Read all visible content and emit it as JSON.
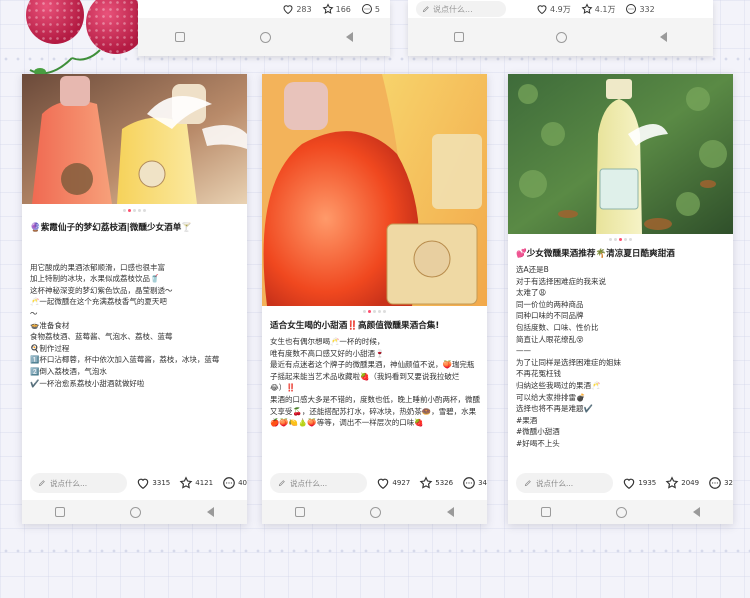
{
  "top": {
    "left": {
      "likes": "283",
      "stars": "166",
      "comments": "5"
    },
    "right": {
      "comment_placeholder": "说点什么...",
      "likes": "4.9万",
      "stars": "4.1万",
      "comments": "332"
    }
  },
  "posts": [
    {
      "title": "🔮紫霞仙子的梦幻荔枝酒|微醺少女酒单🍸",
      "body": "\n用它酸成的果酒浓郁顺滑，口感也很丰富\n加上特制的冰块，水果似成荔枝饮品🥤\n这杯神秘深变的梦幻紫色饮品，晶莹剔透～\n🥂一起微醺在这个充满荔枝香气的夏天吧\n～\n🍲准备食材\n食物荔枝酒、蓝莓酱、气泡水、荔枝、蓝莓\n🍳制作过程\n1️⃣杯口沾椰蓉，杯中依次加入蓝莓酱，荔枝，冰块，蓝莓\n2️⃣倒入荔枝酒，气泡水\n✔️一杯治愈系荔枝小甜酒就做好啦",
      "comment_placeholder": "说点什么...",
      "likes": "3315",
      "stars": "4121",
      "comments": "40"
    },
    {
      "title": "适合女生喝的小甜酒‼️高颜值微醺果酒合集!",
      "body": "女生也有偶尔想喝🥂一杯的时候，\n唯有度数不高口感又好的小甜酒🍷\n最近有点迷者这个牌子的微醺果酒，神仙颜值不说，🍑瑞完瓶子摇起来能当艺术品收藏啦🍓（我妈看到又要说我拉破烂😂）‼️\n果酒的口感大多是不错的，度数也低，晚上睡前小酌两杯，微醺又享受🍒，还能搭配苏打水，碎冰块，热奶茶🍩，雪碧，水果🍎🍑🍋🍐🍑等等，调出不一样层次的口味🍓",
      "comment_placeholder": "说点什么...",
      "likes": "4927",
      "stars": "5326",
      "comments": "34"
    },
    {
      "title": "💕少女微醺果酒推荐🌴清凉夏日酷爽甜酒",
      "body": "选A还是B\n对于有选择困难症的我来说\n太难了😩\n同一价位的两种商品\n同种口味的不同品牌\n包括度数、口味、性价比\n简直让人眼花缭乱😵\n——\n为了让同样是选择困难症的姐妹\n不再花冤枉钱\n归纳这些我喝过的果酒🥂\n可以给大家排排雷💣\n选择也将不再是难题✔️\n#果酒\n#微醺小甜酒\n#好喝不上头",
      "comment_placeholder": "说点什么...",
      "likes": "1935",
      "stars": "2049",
      "comments": "32"
    }
  ],
  "colors": {
    "accent": "#ff4d6d",
    "lychee": "#c9204b",
    "bg": "#f3f3fa"
  }
}
